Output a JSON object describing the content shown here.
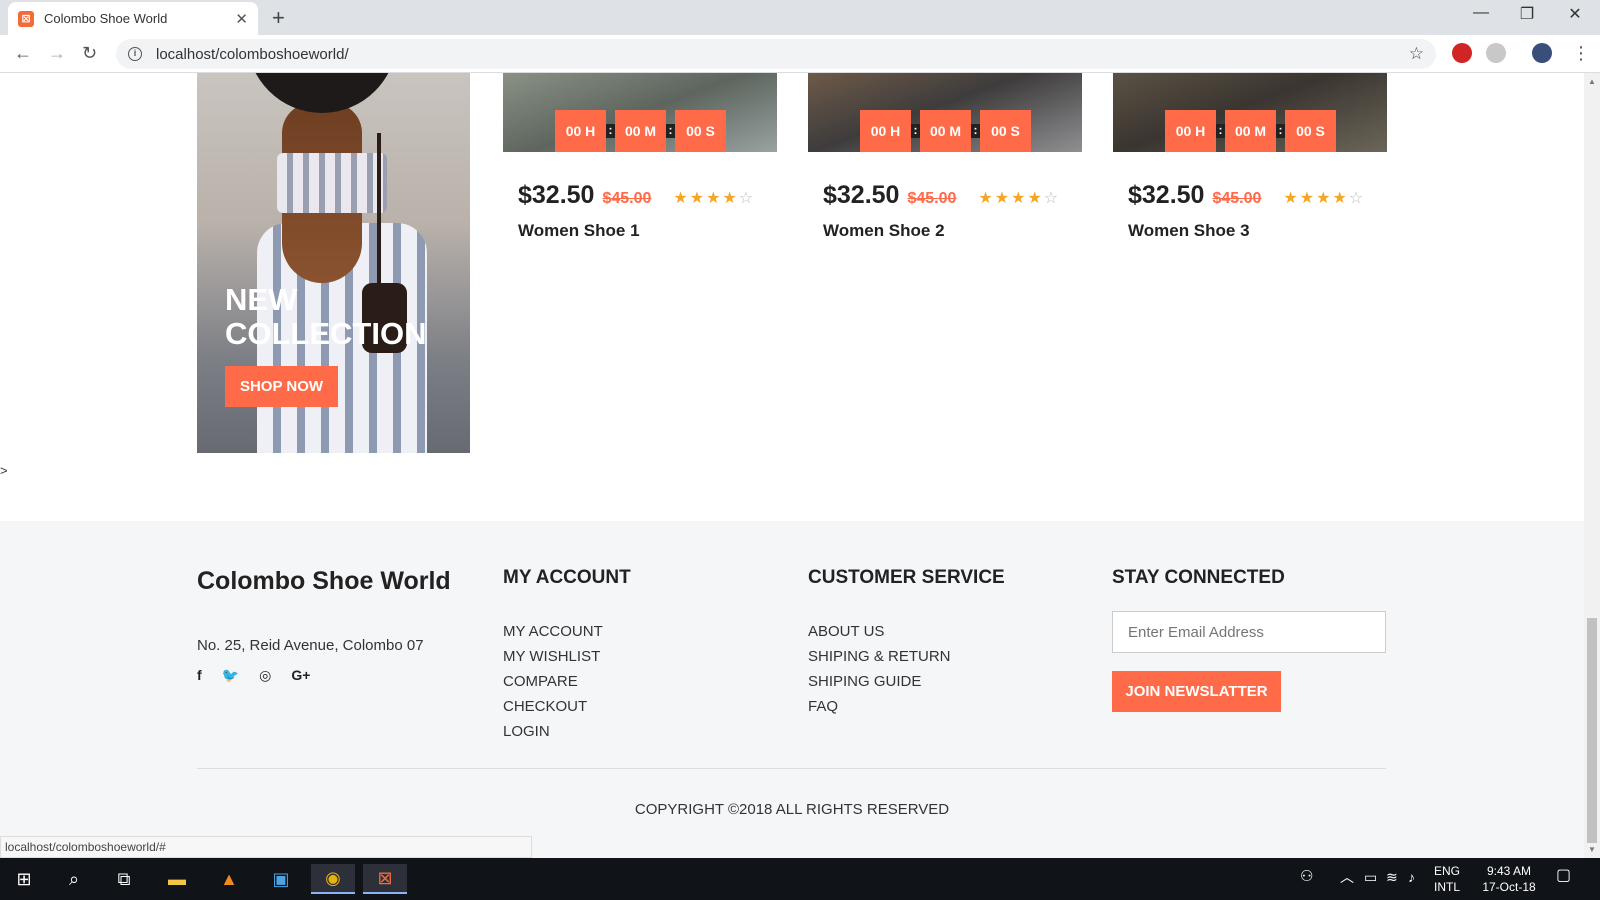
{
  "browser": {
    "tab_title": "Colombo Shoe World",
    "url": "localhost/colomboshoeworld/",
    "status_url": "localhost/colomboshoeworld/#"
  },
  "banner": {
    "title_line1": "NEW",
    "title_line2": "COLLECTION",
    "button": "SHOP NOW"
  },
  "products": [
    {
      "name": "Women Shoe 1",
      "price": "$32.50",
      "old_price": "$45.00",
      "rating": 4,
      "hours": "00 H",
      "minutes": "00 M",
      "seconds": "00 S"
    },
    {
      "name": "Women Shoe 2",
      "price": "$32.50",
      "old_price": "$45.00",
      "rating": 4,
      "hours": "00 H",
      "minutes": "00 M",
      "seconds": "00 S"
    },
    {
      "name": "Women Shoe 3",
      "price": "$32.50",
      "old_price": "$45.00",
      "rating": 4,
      "hours": "00 H",
      "minutes": "00 M",
      "seconds": "00 S"
    }
  ],
  "stray_text": ">",
  "footer": {
    "brand": "Colombo Shoe World",
    "address": "No. 25, Reid Avenue, Colombo 07",
    "social": [
      "f",
      "🐦",
      "◎",
      "G+"
    ],
    "my_account": {
      "heading": "MY ACCOUNT",
      "links": [
        "MY ACCOUNT",
        "MY WISHLIST",
        "COMPARE",
        "CHECKOUT",
        "LOGIN"
      ]
    },
    "customer_service": {
      "heading": "CUSTOMER SERVICE",
      "links": [
        "ABOUT US",
        "SHIPING & RETURN",
        "SHIPING GUIDE",
        "FAQ"
      ]
    },
    "stay_connected": {
      "heading": "STAY CONNECTED",
      "email_placeholder": "Enter Email Address",
      "button": "JOIN NEWSLATTER"
    },
    "copyright": "COPYRIGHT ©2018 ALL RIGHTS RESERVED"
  },
  "taskbar": {
    "lang1": "ENG",
    "lang2": "INTL",
    "time": "9:43 AM",
    "date": "17-Oct-18"
  },
  "colors": {
    "accent": "#ff6a48",
    "star": "#f5a623",
    "footer_bg": "#f5f6f8"
  }
}
